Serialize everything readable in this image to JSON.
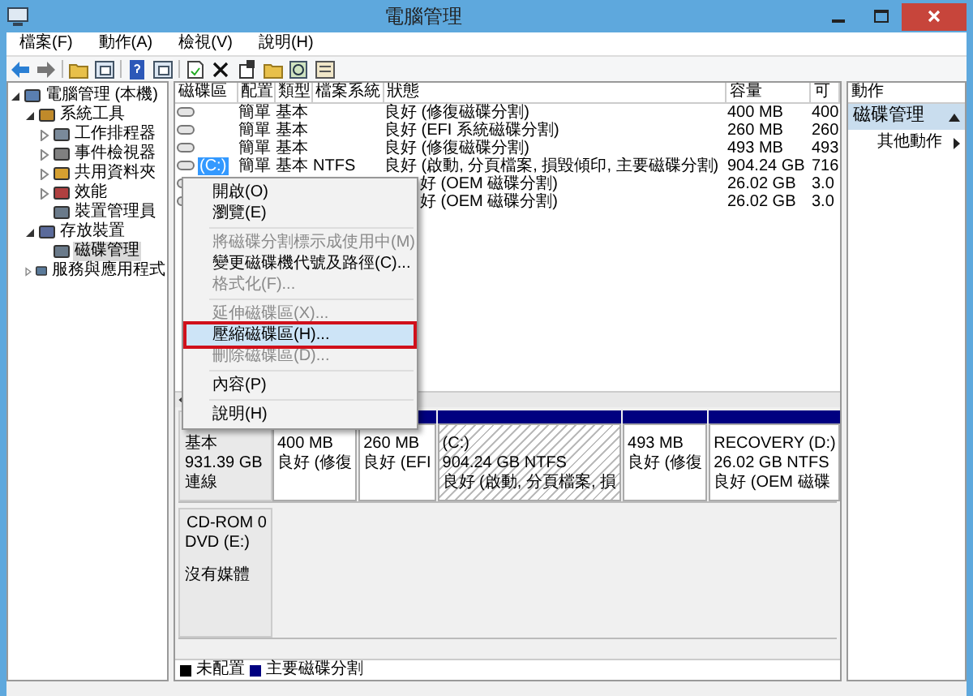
{
  "window": {
    "title": "電腦管理"
  },
  "menu_bar": [
    "檔案(F)",
    "動作(A)",
    "檢視(V)",
    "說明(H)"
  ],
  "tree": [
    {
      "label": "電腦管理 (本機)",
      "expanded": true,
      "selected": false,
      "children": [
        {
          "label": "系統工具",
          "expanded": true,
          "selected": false,
          "children": [
            {
              "label": "工作排程器",
              "expanded": false,
              "selected": false
            },
            {
              "label": "事件檢視器",
              "expanded": false,
              "selected": false
            },
            {
              "label": "共用資料夾",
              "expanded": false,
              "selected": false
            },
            {
              "label": "效能",
              "expanded": false,
              "selected": false
            },
            {
              "label": "裝置管理員",
              "selected": false
            }
          ]
        },
        {
          "label": "存放裝置",
          "expanded": true,
          "selected": false,
          "children": [
            {
              "label": "磁碟管理",
              "selected": true
            }
          ]
        },
        {
          "label": "服務與應用程式",
          "expanded": false,
          "selected": false
        }
      ]
    }
  ],
  "volumes": {
    "columns": [
      "磁碟區",
      "配置",
      "類型",
      "檔案系統",
      "狀態",
      "容量",
      "可"
    ],
    "rows": [
      {
        "selected": false,
        "cells": [
          "",
          "簡單",
          "基本",
          "",
          "良好 (修復磁碟分割)",
          "400 MB",
          "400"
        ]
      },
      {
        "selected": false,
        "cells": [
          "",
          "簡單",
          "基本",
          "",
          "良好 (EFI 系統磁碟分割)",
          "260 MB",
          "260"
        ]
      },
      {
        "selected": false,
        "cells": [
          "",
          "簡單",
          "基本",
          "",
          "良好 (修復磁碟分割)",
          "493 MB",
          "493"
        ]
      },
      {
        "selected": true,
        "cells": [
          "(C:)",
          "簡單",
          "基本",
          "NTFS",
          "良好 (啟動, 分頁檔案, 損毀傾印, 主要磁碟分割)",
          "904.24 GB",
          "716"
        ]
      },
      {
        "selected": false,
        "cells": [
          "",
          "",
          "",
          "",
          "好 (OEM 磁碟分割)",
          "26.02 GB",
          "3.0"
        ]
      },
      {
        "selected": false,
        "cells": [
          "",
          "",
          "",
          "",
          "好 (OEM 磁碟分割)",
          "26.02 GB",
          "3.0"
        ]
      }
    ]
  },
  "context_menu": [
    {
      "kind": "item",
      "label": "開啟(O)",
      "disabled": false,
      "selected": false
    },
    {
      "kind": "item",
      "label": "瀏覽(E)",
      "disabled": false,
      "selected": false
    },
    {
      "kind": "separator"
    },
    {
      "kind": "item",
      "label": "將磁碟分割標示成使用中(M)",
      "disabled": true,
      "selected": false
    },
    {
      "kind": "item",
      "label": "變更磁碟機代號及路徑(C)...",
      "disabled": false,
      "selected": false
    },
    {
      "kind": "item",
      "label": "格式化(F)...",
      "disabled": true,
      "selected": false
    },
    {
      "kind": "separator"
    },
    {
      "kind": "item",
      "label": "延伸磁碟區(X)...",
      "disabled": true,
      "selected": false
    },
    {
      "kind": "item",
      "label": "壓縮磁碟區(H)...",
      "disabled": false,
      "selected": true
    },
    {
      "kind": "item",
      "label": "刪除磁碟區(D)...",
      "disabled": true,
      "selected": false
    },
    {
      "kind": "separator"
    },
    {
      "kind": "item",
      "label": "內容(P)",
      "disabled": false,
      "selected": false
    },
    {
      "kind": "separator"
    },
    {
      "kind": "item",
      "label": "說明(H)",
      "disabled": false,
      "selected": false
    }
  ],
  "disks": [
    {
      "kind": "disk",
      "lines": [
        "基本",
        "931.39 GB",
        "連線"
      ],
      "partitions": [
        {
          "lines": [
            "400 MB",
            "良好 (修復"
          ],
          "selected": false
        },
        {
          "lines": [
            "260 MB",
            "良好 (EFI"
          ],
          "selected": false
        },
        {
          "lines": [
            "(C:)",
            "904.24 GB NTFS",
            "良好 (啟動, 分頁檔案, 損"
          ],
          "selected": true
        },
        {
          "lines": [
            "493 MB",
            "良好 (修復"
          ],
          "selected": false
        },
        {
          "lines": [
            "RECOVERY  (D:)",
            "26.02 GB NTFS",
            "良好 (OEM 磁碟"
          ],
          "selected": false
        }
      ]
    },
    {
      "kind": "cdrom",
      "name": "CD-ROM 0",
      "lines": [
        "DVD (E:)",
        "沒有媒體"
      ]
    }
  ],
  "legend": [
    {
      "label": "未配置",
      "color": "#000000"
    },
    {
      "label": "主要磁碟分割",
      "color": "#000080"
    }
  ],
  "actions_pane": {
    "header": "動作",
    "section": "磁碟管理",
    "items": [
      "其他動作"
    ]
  }
}
